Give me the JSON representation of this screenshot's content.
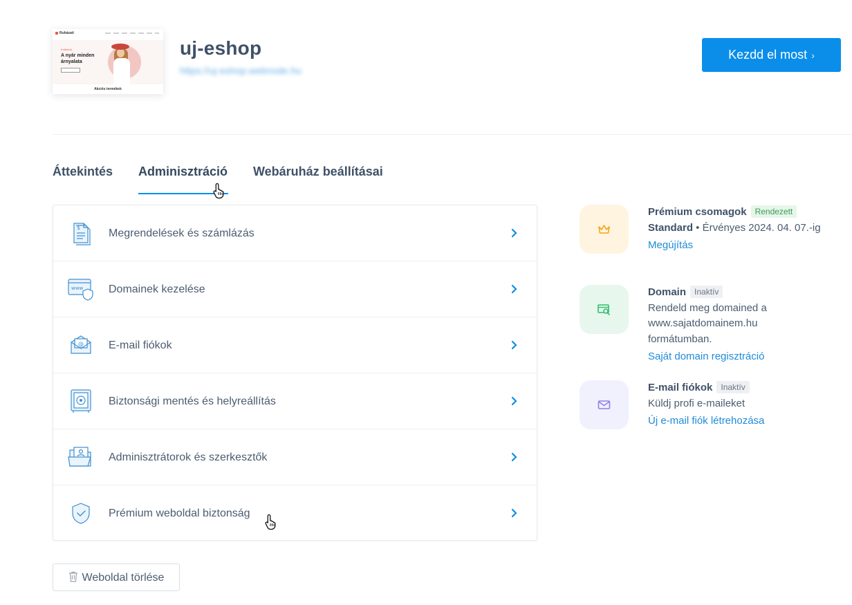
{
  "header": {
    "site_name": "uj-eshop",
    "site_url": "https://uj-eshop.webnode.hu",
    "cta_label": "Kezdd el most",
    "cta_chevron": "›",
    "thumbnail": {
      "logo": "Ruházati",
      "kicker": "Kollekció",
      "headline": "A nyár minden árnyalata",
      "footer": "Akciós termékek"
    }
  },
  "tabs": [
    {
      "label": "Áttekintés",
      "active": false
    },
    {
      "label": "Adminisztráció",
      "active": true
    },
    {
      "label": "Webáruház beállításai",
      "active": false
    }
  ],
  "admin_items": [
    {
      "label": "Megrendelések és számlázás",
      "icon": "invoice-icon"
    },
    {
      "label": "Domainek kezelése",
      "icon": "domain-icon"
    },
    {
      "label": "E-mail fiókok",
      "icon": "email-icon"
    },
    {
      "label": "Biztonsági mentés és helyreállítás",
      "icon": "safe-icon"
    },
    {
      "label": "Adminisztrátorok és szerkesztők",
      "icon": "users-folder-icon"
    },
    {
      "label": "Prémium weboldal biztonság",
      "icon": "shield-check-icon"
    }
  ],
  "services": [
    {
      "title": "Prémium csomagok",
      "badge": "Rendezett",
      "plan": "Standard",
      "line": " • Érvényes 2024. 04. 07.-ig",
      "link": "Megújítás",
      "icon": "crown-icon",
      "tile_color": "#fff4df",
      "icon_color": "#f2a516"
    },
    {
      "title": "Domain",
      "badge": "Inaktív",
      "line": "Rendeld meg domained a www.sajatdomainem.hu formátumban.",
      "link": "Saját domain regisztráció",
      "icon": "domain-search-icon",
      "tile_color": "#e7f7ee",
      "icon_color": "#2fbf6a"
    },
    {
      "title": "E-mail fiókok",
      "badge": "Inaktív",
      "line": "Küldj profi e-maileket",
      "link": "Új e-mail fiók létrehozása",
      "icon": "envelope-icon",
      "tile_color": "#f1f0fd",
      "icon_color": "#8c83e6"
    }
  ],
  "footer": {
    "delete_label": "Weboldal törlése",
    "delete_icon": "trash-icon"
  },
  "colors": {
    "accent": "#0a8eea",
    "link": "#1e8bd8",
    "text": "#4b5c70",
    "heading": "#3f5168"
  }
}
